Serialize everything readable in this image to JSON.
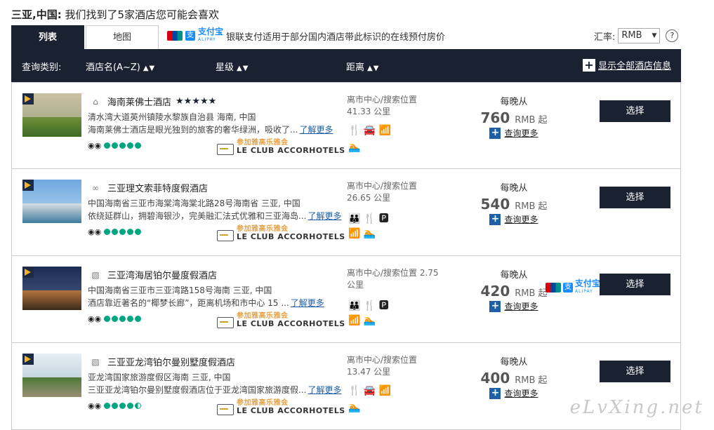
{
  "heading": {
    "location": "三亚,中国:",
    "text": "我们找到了5家酒店您可能会喜欢"
  },
  "tabs": [
    {
      "label": "列表"
    },
    {
      "label": "地图"
    }
  ],
  "pay_note": {
    "alipay_cn": "支付宝",
    "alipay_en": "ALIPAY",
    "text": "银联支付适用于部分国内酒店带此标识的在线预付房价"
  },
  "rate": {
    "label": "汇率:",
    "value": "RMB",
    "help": "?"
  },
  "header": {
    "category_label": "查询类别:",
    "sort_name": "酒店名(A~Z)",
    "sort_star": "星级",
    "sort_distance": "距离",
    "sort_arrows": "▲▼",
    "show_all": "显示全部酒店信息"
  },
  "hotels": [
    {
      "name": "海南莱佛士酒店",
      "stars": "★★★★★",
      "address": "清水湾大道英州镇陵水黎族自治县 海南, 中国",
      "desc": "海南莱佛士酒店是眼光独到的旅客的奢华绿洲，吸收了...",
      "more_link": "了解更多",
      "club_cn": "参加雅高乐雅会",
      "club_en": "LE CLUB ACCORHOTELS",
      "distance": "离市中心/搜索位置\n41.33 公里",
      "amenities_row1": "🍴 🚘 📶",
      "amenities_row2": "🏊",
      "per_night": "每晚从",
      "price": "760",
      "currency": "RMB 起",
      "query_more": "查询更多",
      "select": "选择"
    },
    {
      "name": "三亚理文索菲特度假酒店",
      "stars": "",
      "address": "中国海南省三亚市海棠湾海棠北路28号海南省 三亚, 中国",
      "desc": "依绕延群山，拥碧海银沙，完美融汇法式优雅和三亚海岛...",
      "more_link": "了解更多",
      "club_cn": "参加雅高乐雅会",
      "club_en": "LE CLUB ACCORHOTELS",
      "distance": "离市中心/搜索位置\n26.65 公里",
      "amenities_row1": "👪 🍴 🅿",
      "amenities_row2": "📶 🏊",
      "per_night": "每晚从",
      "price": "540",
      "currency": "RMB 起",
      "query_more": "查询更多",
      "select": "选择"
    },
    {
      "name": "三亚湾海居铂尔曼度假酒店",
      "stars": "",
      "address": "中国海南省三亚市三亚湾路158号海南 三亚, 中国",
      "desc": "酒店靠近著名的“椰梦长廊”，距离机场和市中心 15 ...",
      "more_link": "了解更多",
      "club_cn": "参加雅高乐雅会",
      "club_en": "LE CLUB ACCORHOTELS",
      "distance": "离市中心/搜索位置 2.75\n公里",
      "amenities_row1": "👪 🍴 🅿",
      "amenities_row2": "📶 🏊",
      "per_night": "每晚从",
      "price": "420",
      "currency": "RMB 起",
      "query_more": "查询更多",
      "select": "选择",
      "alipay_cn": "支付宝",
      "alipay_en": "ALIPAY"
    },
    {
      "name": "三亚亚龙湾铂尔曼别墅度假酒店",
      "stars": "",
      "address": "亚龙湾国家旅游度假区海南 三亚, 中国",
      "desc": "三亚亚龙湾铂尔曼别墅度假酒店位于亚龙湾国家旅游度假...",
      "more_link": "了解更多",
      "club_cn": "参加雅高乐雅会",
      "club_en": "LE CLUB ACCORHOTELS",
      "distance": "离市中心/搜索位置\n13.47 公里",
      "amenities_row1": "🍴 🚘 📶",
      "amenities_row2": "🏊",
      "per_night": "每晚从",
      "price": "400",
      "currency": "RMB 起",
      "query_more": "查询更多",
      "select": "选择"
    }
  ],
  "watermark": "eLvXing.net"
}
